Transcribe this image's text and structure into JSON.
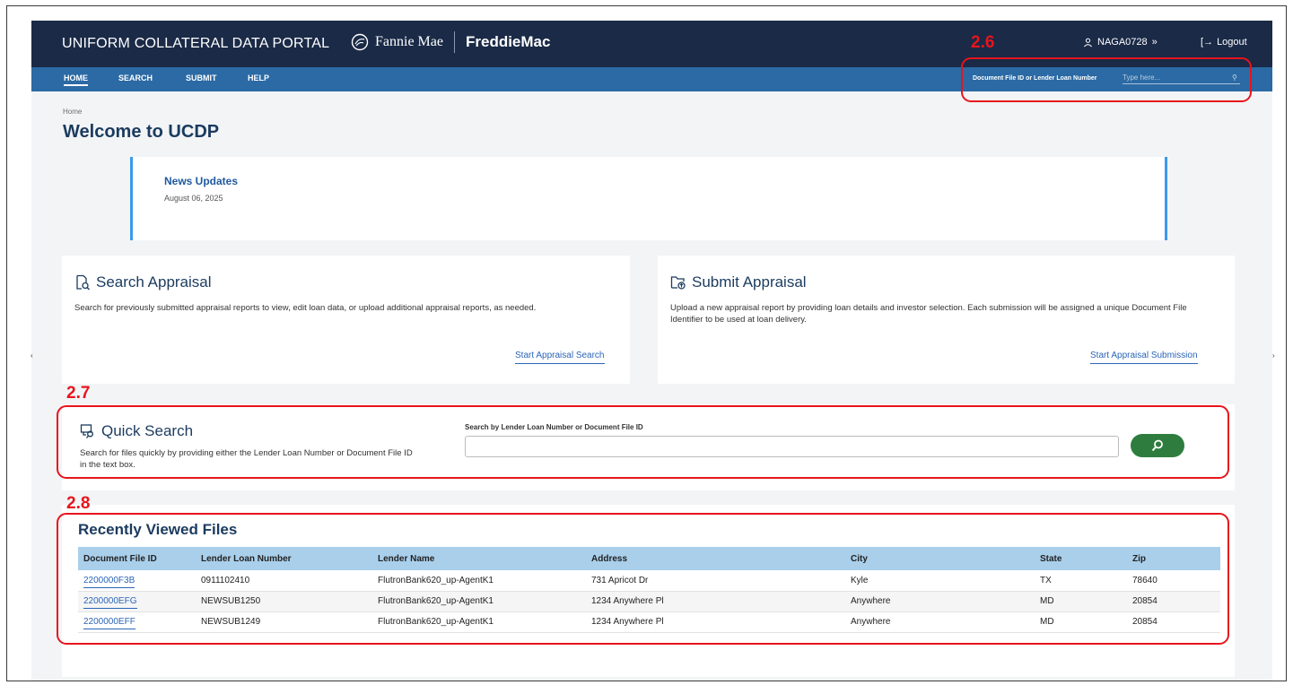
{
  "header": {
    "portal_title": "UNIFORM COLLATERAL DATA PORTAL",
    "brand_fannie": "Fannie Mae",
    "brand_freddie": "FreddieMac",
    "user": "NAGA0728",
    "logout": "Logout"
  },
  "nav": {
    "items": [
      {
        "label": "HOME",
        "active": true
      },
      {
        "label": "SEARCH"
      },
      {
        "label": "SUBMIT"
      },
      {
        "label": "HELP"
      }
    ],
    "search_label": "Document File ID or Lender Loan Number",
    "search_placeholder": "Type here..."
  },
  "breadcrumb": "Home",
  "page_title": "Welcome to UCDP",
  "news": {
    "title": "News Updates",
    "date": "August 06, 2025"
  },
  "search_card": {
    "title": "Search Appraisal",
    "description": "Search for previously submitted appraisal reports to view, edit loan data, or upload additional appraisal reports, as needed.",
    "link": "Start Appraisal Search"
  },
  "submit_card": {
    "title": "Submit Appraisal",
    "description": "Upload a new appraisal report by providing loan details and investor selection. Each submission will be assigned a unique Document File Identifier to be used at loan delivery.",
    "link": "Start Appraisal Submission"
  },
  "quick_search": {
    "title": "Quick Search",
    "description": "Search for files quickly by providing either the Lender Loan Number or Document File ID in the text box.",
    "field_label": "Search by Lender Loan Number or Document File ID",
    "value": ""
  },
  "recent": {
    "title": "Recently Viewed Files",
    "columns": [
      "Document File ID",
      "Lender Loan Number",
      "Lender Name",
      "Address",
      "City",
      "State",
      "Zip"
    ],
    "rows": [
      [
        "2200000F3B",
        "0911102410",
        "FlutronBank620_up-AgentK1",
        "731 Apricot Dr",
        "Kyle",
        "TX",
        "78640"
      ],
      [
        "2200000EFG",
        "NEWSUB1250",
        "FlutronBank620_up-AgentK1",
        "1234 Anywhere Pl",
        "Anywhere",
        "MD",
        "20854"
      ],
      [
        "2200000EFF",
        "NEWSUB1249",
        "FlutronBank620_up-AgentK1",
        "1234 Anywhere Pl",
        "Anywhere",
        "MD",
        "20854"
      ]
    ]
  },
  "annotations": [
    "2.6",
    "2.7",
    "2.8"
  ],
  "colors": {
    "topbar": "#1a2a47",
    "navbar": "#2b6aa4",
    "accent": "#3a9ae8",
    "search_button": "#2e7d3e",
    "annotation": "#e8141c"
  }
}
